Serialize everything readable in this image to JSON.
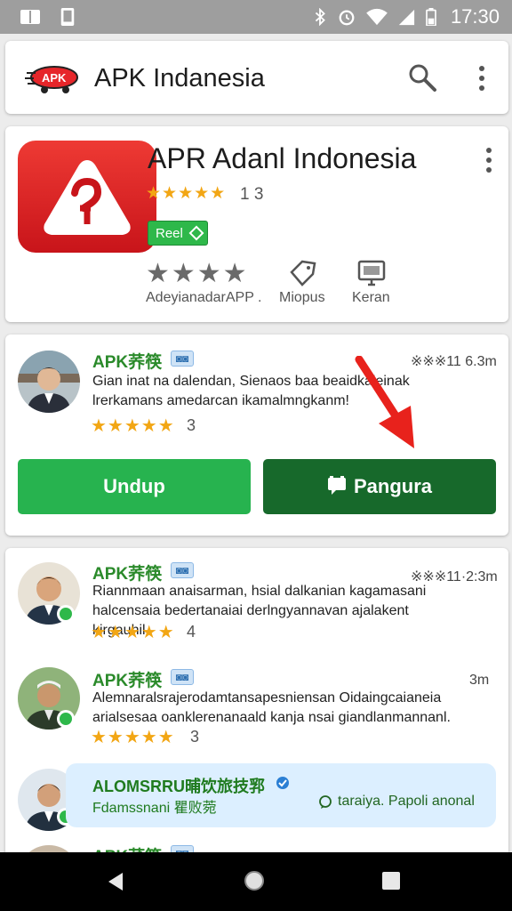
{
  "status_bar": {
    "time": "17:30",
    "icons": [
      "book-icon",
      "phone-icon",
      "bluetooth-icon",
      "alarm-icon",
      "wifi-icon",
      "signal-icon",
      "battery-icon"
    ]
  },
  "app_bar": {
    "logo_text": "APK",
    "title": "APK Indanesia",
    "icons": [
      "search-icon",
      "more-vert-icon"
    ]
  },
  "app": {
    "name": "APR Adanl Indonesia",
    "stars_text": "★★★★★",
    "rating_count": "1 3",
    "badge_label": "Reel",
    "gray_stars": "★★★★",
    "developer": "AdeyianadarAPP .",
    "actions": [
      {
        "label": "Miopus",
        "icon": "tag-icon"
      },
      {
        "label": "Keran",
        "icon": "monitor-icon"
      }
    ],
    "colors": {
      "icon_red": "#d9221f",
      "accent_green": "#27b34f",
      "dark_green": "#17692b"
    }
  },
  "featured_review": {
    "name": "APK荞筷",
    "tag": "◙◙",
    "time": "※※※11 6.3m",
    "text": "Gian inat na dalendan, Sienaos baa beaidkaieinak lrerkamans amedarcan ikamalmngkanm!",
    "stars": "★★★★★",
    "count": "3",
    "buttons": {
      "left": "Undup",
      "right": "Pangura"
    }
  },
  "reviews": [
    {
      "name": "APK荞筷",
      "tag": "◙◙",
      "time": "※※※11·2:3m",
      "text": "Riannmaan anaisarman, hsial dalkanian kagamasani halcensaia bedertanaiai derlngyannavan ajalakent kirgauhil.",
      "stars": "★★★★★",
      "count": "4"
    },
    {
      "name": "APK荞筷",
      "tag": "◙◙",
      "time": "3m",
      "text": "Alemnaralsrajerodamtansapesniensan Oidaingcaianeia arialsesaa oanklerenanaald kanja nsai giandlanmannanl.",
      "stars": "★★★★★",
      "count": "3"
    }
  ],
  "highlight": {
    "name": "ALOMSRRU晡饮旅技郛",
    "sub": "Fdamssnani 瞿败菀",
    "link": "taraiya. Papoli anonal",
    "verified_icon": "verified-icon",
    "chat_icon": "chat-icon"
  },
  "partial_review": {
    "name": "APK荞筷"
  },
  "nav_bar": {
    "icons": [
      "back-icon",
      "home-icon",
      "recents-icon"
    ]
  }
}
